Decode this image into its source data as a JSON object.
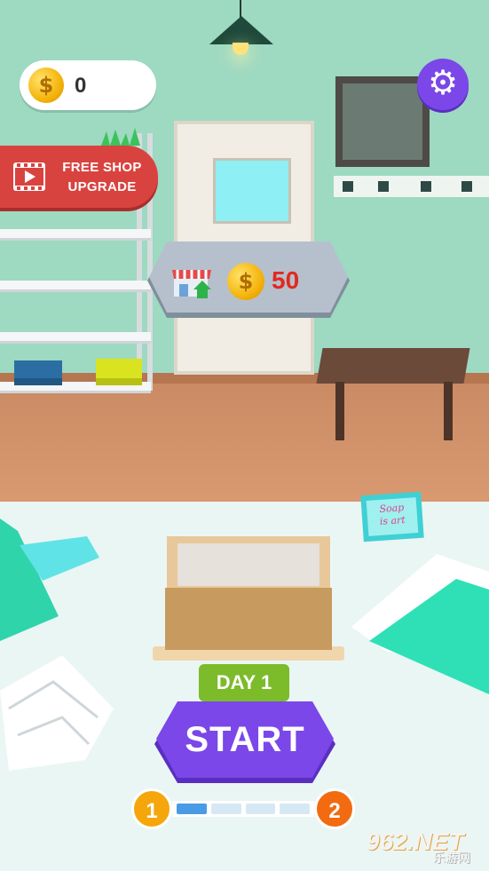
{
  "hud": {
    "coin_balance": "0",
    "coin_symbol": "$",
    "settings_icon": "gear-icon"
  },
  "free_shop": {
    "line1": "FREE SHOP",
    "line2": "UPGRADE",
    "icon": "video-icon"
  },
  "upgrade": {
    "icon": "shop-upgrade-icon",
    "coin_symbol": "$",
    "price": "50"
  },
  "scene": {
    "sign_line1": "Soap",
    "sign_line2": "is art"
  },
  "game": {
    "day_label": "DAY 1",
    "start_label": "START"
  },
  "progress": {
    "current_level": "1",
    "next_level": "2",
    "segments_total": 4,
    "segments_filled": 1
  },
  "watermark": {
    "brand": "962.NET",
    "sub": "乐游网"
  },
  "colors": {
    "accent_purple": "#7b47e8",
    "free_shop_red": "#d9433f",
    "day_green": "#7cbb2a",
    "price_red": "#e12a1f",
    "progress_blue": "#4a9be6"
  }
}
